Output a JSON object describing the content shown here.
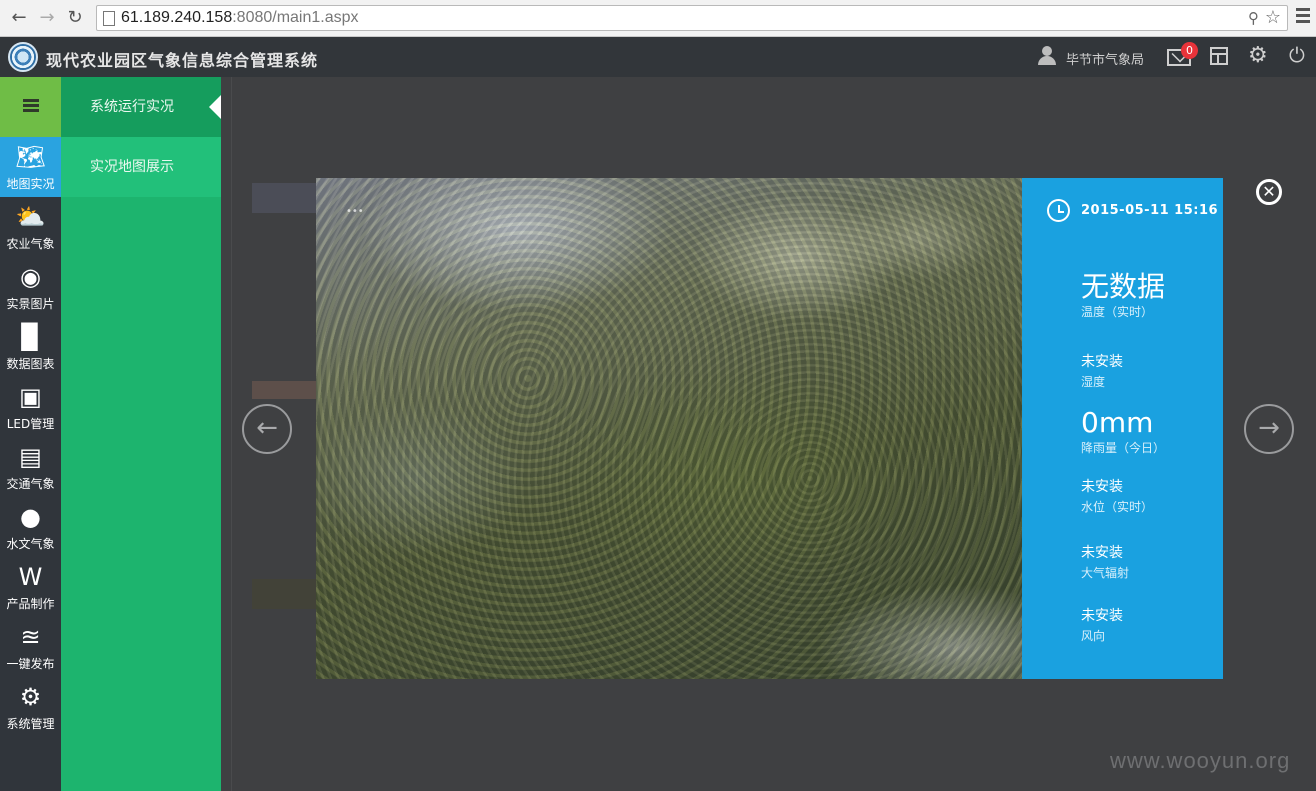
{
  "browser": {
    "url_host": "61.189.240.158",
    "url_rest": ":8080/main1.aspx"
  },
  "header": {
    "title": "现代农业园区气象信息综合管理系统",
    "user": "毕节市气象局",
    "mail_count": "0"
  },
  "sidebar": {
    "items": [
      {
        "label": "地图实况",
        "icon": "map-icon"
      },
      {
        "label": "农业气象",
        "icon": "weather-icon"
      },
      {
        "label": "实景图片",
        "icon": "camera-icon"
      },
      {
        "label": "数据图表",
        "icon": "bar-chart-icon"
      },
      {
        "label": "LED管理",
        "icon": "monitor-icon"
      },
      {
        "label": "交通气象",
        "icon": "train-icon"
      },
      {
        "label": "水文气象",
        "icon": "drop-icon"
      },
      {
        "label": "产品制作",
        "icon": "word-icon"
      },
      {
        "label": "一键发布",
        "icon": "wifi-icon"
      },
      {
        "label": "系统管理",
        "icon": "gear-icon"
      }
    ]
  },
  "submenu": {
    "items": [
      "系统运行实况",
      "实况地图展示"
    ]
  },
  "modal": {
    "datetime": "2015-05-11 15:16",
    "metrics": [
      {
        "value": "无数据",
        "caption": "温度（实时）"
      },
      {
        "value": "未安装",
        "caption": "湿度"
      },
      {
        "value": "0mm",
        "caption": "降雨量（今日）"
      },
      {
        "value": "未安装",
        "caption": "水位（实时）"
      },
      {
        "value": "未安装",
        "caption": "大气辐射"
      },
      {
        "value": "未安装",
        "caption": "风向"
      }
    ]
  },
  "watermark": "www.wooyun.org",
  "colors": {
    "accent_blue": "#1aa1e0",
    "menu_green": "#1db46e",
    "grid_green": "#6fbd46",
    "badge_red": "#e8333a"
  }
}
